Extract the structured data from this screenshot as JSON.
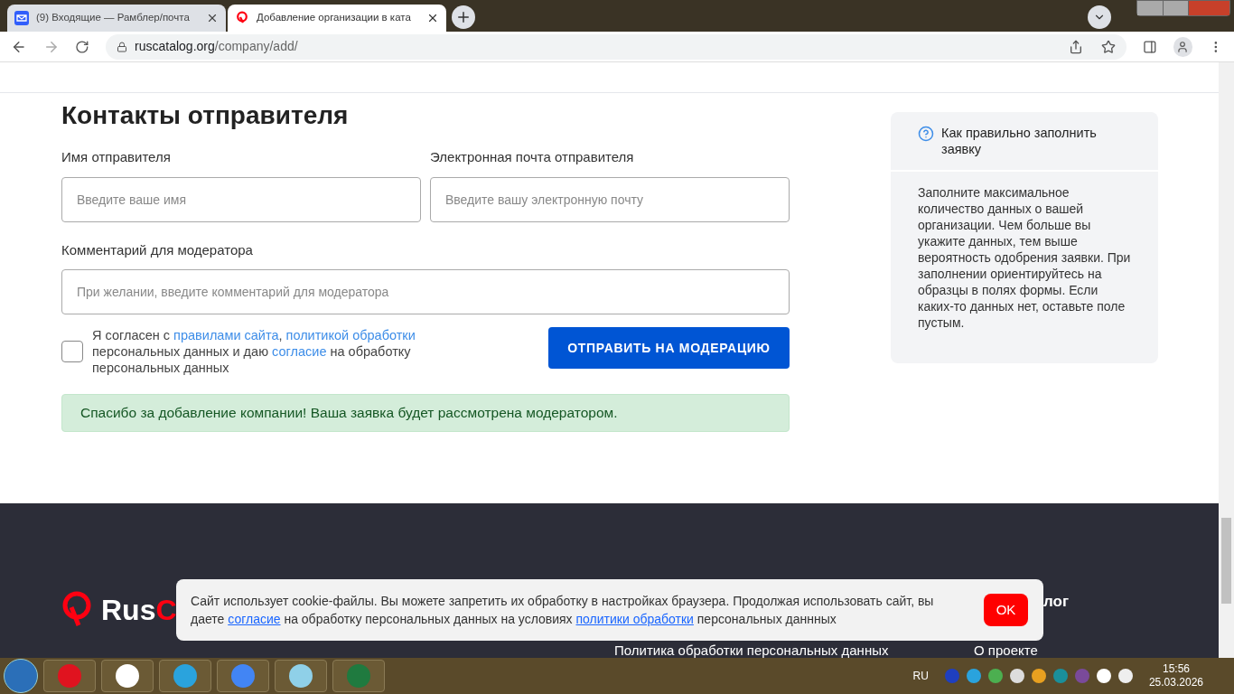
{
  "browser": {
    "tabs": [
      {
        "title": "(9) Входящие — Рамблер/почта",
        "selected": false
      },
      {
        "title": "Добавление организации в ката",
        "selected": true
      }
    ],
    "url_host": "ruscatalog.org",
    "url_path": "/company/add/"
  },
  "form": {
    "heading": "Контакты отправителя",
    "fields": [
      {
        "label": "Имя отправителя",
        "placeholder": "Введите ваше имя"
      },
      {
        "label": "Электронная почта отправителя",
        "placeholder": "Введите вашу электронную почту"
      }
    ],
    "comment": {
      "label": "Комментарий для модератора",
      "placeholder": "При желании, введите комментарий для модератора"
    },
    "agreement": {
      "checked": false,
      "parts": [
        {
          "kind": "text",
          "text": "Я согласен с "
        },
        {
          "kind": "link",
          "text": "правилами сайта"
        },
        {
          "kind": "text",
          "text": ", "
        },
        {
          "kind": "link",
          "text": "политикой обработки"
        },
        {
          "kind": "text",
          "text": " персональных данных и даю "
        },
        {
          "kind": "link",
          "text": "согласие"
        },
        {
          "kind": "text",
          "text": " на обработку персональных данных"
        }
      ]
    },
    "submit": "ОТПРАВИТЬ НА МОДЕРАЦИЮ",
    "success": "Спасибо за добавление компании! Ваша заявка будет рассмотрена модератором."
  },
  "help": {
    "title": "Как правильно заполнить заявку",
    "text": "Заполните максимальное количество данных о вашей организации. Чем больше вы укажите данных, тем выше вероятность одобрения заявки. При заполнении ориентируйтесь на образцы в полях формы. Если каких-то данных нет, оставьте поле пустым."
  },
  "footer": {
    "logo_start": "Rus",
    "logo_end": "C",
    "heading": "лог",
    "links": [
      "Политика обработки персональных данных",
      "О проекте"
    ]
  },
  "cookie": {
    "parts": [
      {
        "kind": "text",
        "text": "Сайт использует cookie-файлы. Вы можете запретить их обработку в настройках браузера. Продолжая использовать сайт, вы даете "
      },
      {
        "kind": "link",
        "text": "согласие"
      },
      {
        "kind": "text",
        "text": " на обработку персональных данных на условиях "
      },
      {
        "kind": "link",
        "text": "политики обработки"
      },
      {
        "kind": "text",
        "text": " персональных даннных"
      }
    ],
    "button": "OK"
  },
  "taskbar": {
    "lang": "RU",
    "time": "15:56",
    "date": "25.03.2026"
  }
}
